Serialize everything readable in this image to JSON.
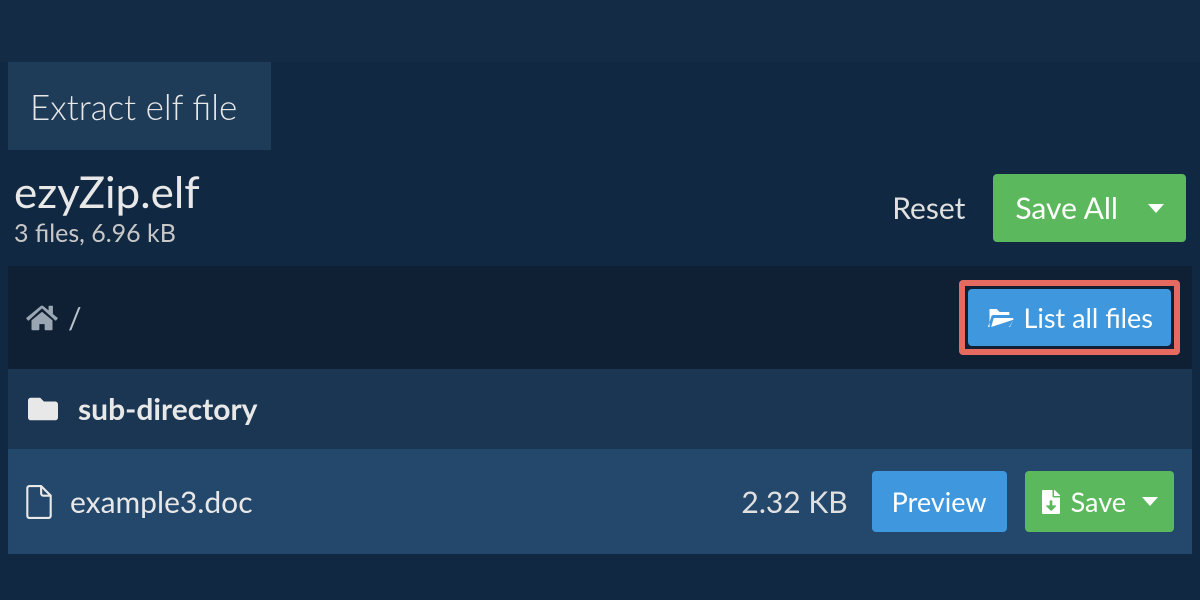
{
  "tab": {
    "label": "Extract elf file"
  },
  "header": {
    "filename": "ezyZip.elf",
    "meta": "3 files, 6.96 kB",
    "reset": "Reset",
    "save_all": "Save All"
  },
  "breadcrumb": {
    "sep": "/",
    "list_all": "List all files"
  },
  "rows": {
    "dir": {
      "name": "sub-directory"
    },
    "file": {
      "name": "example3.doc",
      "size": "2.32 KB",
      "preview": "Preview",
      "save": "Save"
    }
  }
}
